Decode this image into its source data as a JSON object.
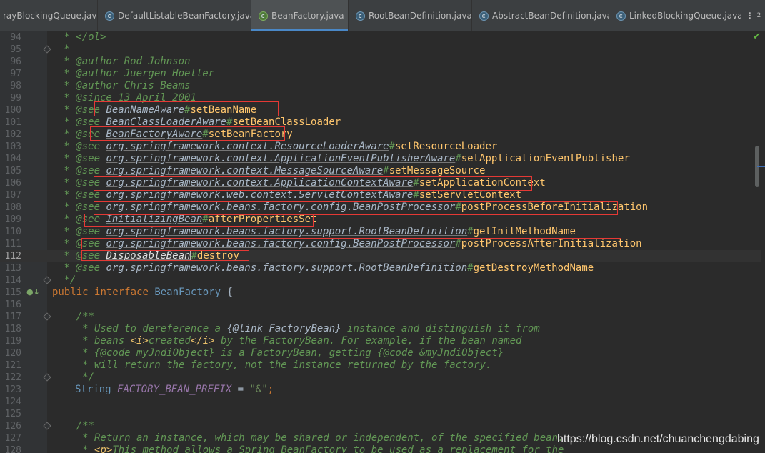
{
  "tabs": [
    {
      "label": "rayBlockingQueue.java",
      "active": false,
      "icon": "class-icon"
    },
    {
      "label": "DefaultListableBeanFactory.java",
      "active": false,
      "icon": "class-icon"
    },
    {
      "label": "BeanFactory.java",
      "active": true,
      "icon": "interface-icon"
    },
    {
      "label": "RootBeanDefinition.java",
      "active": false,
      "icon": "class-icon"
    },
    {
      "label": "AbstractBeanDefinition.java",
      "active": false,
      "icon": "class-icon"
    },
    {
      "label": "LinkedBlockingQueue.java",
      "active": false,
      "icon": "class-icon"
    }
  ],
  "tab_close_glyph": "×",
  "more_tabs": {
    "dots": "⋮",
    "count": "2"
  },
  "line_numbers": [
    "94",
    "95",
    "96",
    "97",
    "98",
    "99",
    "100",
    "101",
    "102",
    "103",
    "104",
    "105",
    "106",
    "107",
    "108",
    "109",
    "110",
    "111",
    "112",
    "113",
    "114",
    "115",
    "116",
    "117",
    "118",
    "119",
    "120",
    "121",
    "122",
    "123",
    "124",
    "125",
    "126",
    "127",
    "128"
  ],
  "code": {
    "l94": " * </ol>",
    "l95": " *",
    "l96": " * @author Rod Johnson",
    "l97": " * @author Juergen Hoeller",
    "l98": " * @author Chris Beams",
    "l99": " * @since 13 April 2001",
    "see": " * @see ",
    "hash": "#",
    "l100_cls": "BeanNameAware",
    "l100_m": "setBeanName",
    "l101_cls": "BeanClassLoaderAware",
    "l101_m": "setBeanClassLoader",
    "l102_cls": "BeanFactoryAware",
    "l102_m": "setBeanFactory",
    "l103_cls": "org.springframework.context.ResourceLoaderAware",
    "l103_m": "setResourceLoader",
    "l104_cls": "org.springframework.context.ApplicationEventPublisherAware",
    "l104_m": "setApplicationEventPublisher",
    "l105_cls": "org.springframework.context.MessageSourceAware",
    "l105_m": "setMessageSource",
    "l106_cls": "org.springframework.context.ApplicationContextAware",
    "l106_m": "setApplicationContext",
    "l107_cls": "org.springframework.web.context.ServletContextAware",
    "l107_m": "setServletContext",
    "l108_cls": "org.springframework.beans.factory.config.BeanPostProcessor",
    "l108_m": "postProcessBeforeInitialization",
    "l109_cls": "InitializingBean",
    "l109_m": "afterPropertiesSet",
    "l110_cls": "org.springframework.beans.factory.support.RootBeanDefinition",
    "l110_m": "getInitMethodName",
    "l111_cls": "org.springframework.beans.factory.config.BeanPostProcessor",
    "l111_m": "postProcessAfterInitialization",
    "l112_cls": "DisposableBean",
    "l112_m": "destroy",
    "l113_cls": "org.springframework.beans.factory.support.RootBeanDefinition",
    "l113_m": "getDestroyMethodName",
    "l114": " */",
    "l115_kw1": "public",
    "l115_kw2": "interface",
    "l115_name": "BeanFactory",
    "l115_brace": " {",
    "l117": "    /**",
    "l118_a": "     * Used to dereference a ",
    "l118_b": "{@link ",
    "l118_c": "FactoryBean",
    "l118_d": "}",
    "l118_e": " instance and distinguish it from",
    "l119_a": "     * beans ",
    "l119_b": "<i>",
    "l119_c": "created",
    "l119_d": "</i>",
    "l119_e": " by the FactoryBean. For example, if the bean named",
    "l120": "     * {@code myJndiObject} is a FactoryBean, getting {@code &myJndiObject}",
    "l121": "     * will return the factory, not the instance returned by the factory.",
    "l122": "     */",
    "l123_type": "String",
    "l123_field": "FACTORY_BEAN_PREFIX",
    "l123_eq": " = ",
    "l123_str": "\"&\"",
    "l123_semi": ";",
    "l126": "    /**",
    "l127": "     * Return an instance, which may be shared or independent, of the specified bean.",
    "l128_a": "     * ",
    "l128_b": "<p>",
    "l128_c": "This method allows a Spring BeanFactory to be used as a replacement for the"
  },
  "watermark": "https://blog.csdn.net/chuanchengdabing",
  "colors": {
    "background": "#2b2b2b",
    "highlight_box": "#e53935",
    "comment": "#629755",
    "method": "#ffc66d"
  }
}
